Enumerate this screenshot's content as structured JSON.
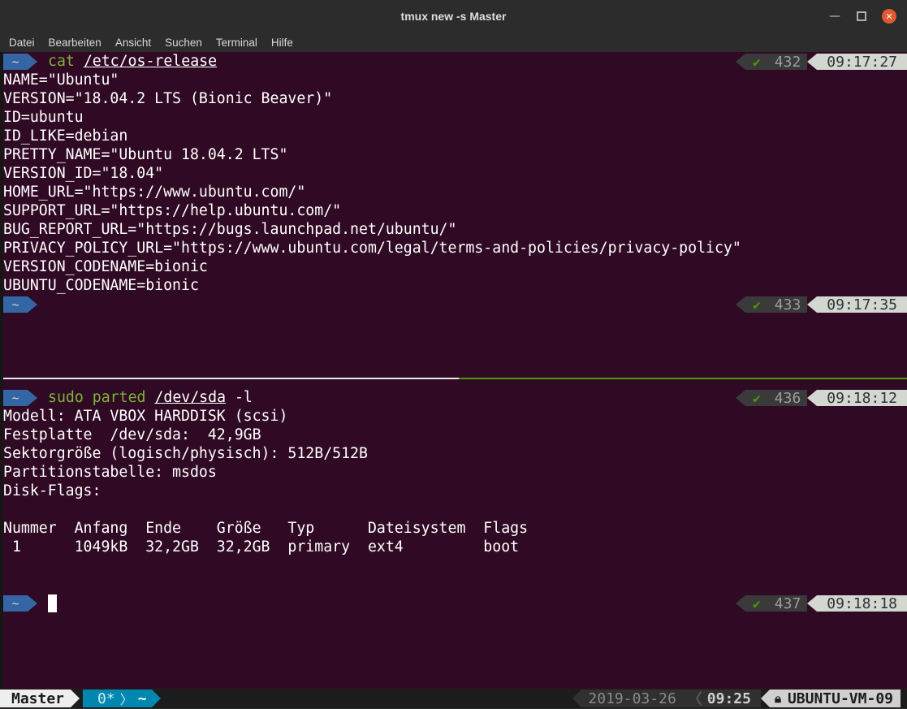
{
  "window": {
    "title": "tmux new -s Master",
    "minimize_icon": "minimize-icon",
    "maximize_icon": "maximize-icon",
    "close_icon": "close-icon"
  },
  "menu": [
    "Datei",
    "Bearbeiten",
    "Ansicht",
    "Suchen",
    "Terminal",
    "Hilfe"
  ],
  "prompt_symbol": "~",
  "check_symbol": "✔",
  "pane1": {
    "cmd": {
      "word": "cat",
      "arg": "/etc/os-release"
    },
    "status_top": {
      "num": "432",
      "time": "09:17:27"
    },
    "output": [
      "NAME=\"Ubuntu\"",
      "VERSION=\"18.04.2 LTS (Bionic Beaver)\"",
      "ID=ubuntu",
      "ID_LIKE=debian",
      "PRETTY_NAME=\"Ubuntu 18.04.2 LTS\"",
      "VERSION_ID=\"18.04\"",
      "HOME_URL=\"https://www.ubuntu.com/\"",
      "SUPPORT_URL=\"https://help.ubuntu.com/\"",
      "BUG_REPORT_URL=\"https://bugs.launchpad.net/ubuntu/\"",
      "PRIVACY_POLICY_URL=\"https://www.ubuntu.com/legal/terms-and-policies/privacy-policy\"",
      "VERSION_CODENAME=bionic",
      "UBUNTU_CODENAME=bionic"
    ],
    "status_bottom": {
      "num": "433",
      "time": "09:17:35"
    }
  },
  "pane2": {
    "cmd": {
      "word1": "sudo",
      "word2": "parted",
      "arg": "/dev/sda",
      "flag": "-l"
    },
    "status_top": {
      "num": "436",
      "time": "09:18:12"
    },
    "output": [
      "Modell: ATA VBOX HARDDISK (scsi)",
      "Festplatte  /dev/sda:  42,9GB",
      "Sektorgröße (logisch/physisch): 512B/512B",
      "Partitionstabelle: msdos",
      "Disk-Flags:",
      "",
      "Nummer  Anfang  Ende    Größe   Typ      Dateisystem  Flags",
      " 1      1049kB  32,2GB  32,2GB  primary  ext4         boot"
    ],
    "status_bottom": {
      "num": "437",
      "time": "09:18:18"
    }
  },
  "tmux": {
    "session": "Master",
    "window_index": "0*",
    "window_name": "~",
    "date": "2019-03-26",
    "time": "09:25",
    "host": "UBUNTU-VM-09",
    "lock_icon": "lock-icon"
  },
  "colors": {
    "background": "#300a24",
    "prompt_blue": "#3465a4",
    "command_green": "#7eb338",
    "success_green": "#4e9a06",
    "tmux_window": "#0087af"
  }
}
